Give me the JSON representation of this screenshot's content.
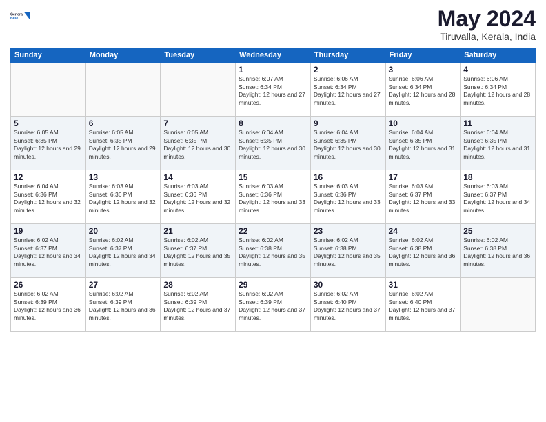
{
  "header": {
    "logo_line1": "General",
    "logo_line2": "Blue",
    "title": "May 2024",
    "subtitle": "Tiruvalla, Kerala, India"
  },
  "weekdays": [
    "Sunday",
    "Monday",
    "Tuesday",
    "Wednesday",
    "Thursday",
    "Friday",
    "Saturday"
  ],
  "weeks": [
    [
      {
        "day": "",
        "empty": true
      },
      {
        "day": "",
        "empty": true
      },
      {
        "day": "",
        "empty": true
      },
      {
        "day": "1",
        "sunrise": "6:07 AM",
        "sunset": "6:34 PM",
        "daylight": "12 hours and 27 minutes."
      },
      {
        "day": "2",
        "sunrise": "6:06 AM",
        "sunset": "6:34 PM",
        "daylight": "12 hours and 27 minutes."
      },
      {
        "day": "3",
        "sunrise": "6:06 AM",
        "sunset": "6:34 PM",
        "daylight": "12 hours and 28 minutes."
      },
      {
        "day": "4",
        "sunrise": "6:06 AM",
        "sunset": "6:34 PM",
        "daylight": "12 hours and 28 minutes."
      }
    ],
    [
      {
        "day": "5",
        "sunrise": "6:05 AM",
        "sunset": "6:35 PM",
        "daylight": "12 hours and 29 minutes."
      },
      {
        "day": "6",
        "sunrise": "6:05 AM",
        "sunset": "6:35 PM",
        "daylight": "12 hours and 29 minutes."
      },
      {
        "day": "7",
        "sunrise": "6:05 AM",
        "sunset": "6:35 PM",
        "daylight": "12 hours and 30 minutes."
      },
      {
        "day": "8",
        "sunrise": "6:04 AM",
        "sunset": "6:35 PM",
        "daylight": "12 hours and 30 minutes."
      },
      {
        "day": "9",
        "sunrise": "6:04 AM",
        "sunset": "6:35 PM",
        "daylight": "12 hours and 30 minutes."
      },
      {
        "day": "10",
        "sunrise": "6:04 AM",
        "sunset": "6:35 PM",
        "daylight": "12 hours and 31 minutes."
      },
      {
        "day": "11",
        "sunrise": "6:04 AM",
        "sunset": "6:35 PM",
        "daylight": "12 hours and 31 minutes."
      }
    ],
    [
      {
        "day": "12",
        "sunrise": "6:04 AM",
        "sunset": "6:36 PM",
        "daylight": "12 hours and 32 minutes."
      },
      {
        "day": "13",
        "sunrise": "6:03 AM",
        "sunset": "6:36 PM",
        "daylight": "12 hours and 32 minutes."
      },
      {
        "day": "14",
        "sunrise": "6:03 AM",
        "sunset": "6:36 PM",
        "daylight": "12 hours and 32 minutes."
      },
      {
        "day": "15",
        "sunrise": "6:03 AM",
        "sunset": "6:36 PM",
        "daylight": "12 hours and 33 minutes."
      },
      {
        "day": "16",
        "sunrise": "6:03 AM",
        "sunset": "6:36 PM",
        "daylight": "12 hours and 33 minutes."
      },
      {
        "day": "17",
        "sunrise": "6:03 AM",
        "sunset": "6:37 PM",
        "daylight": "12 hours and 33 minutes."
      },
      {
        "day": "18",
        "sunrise": "6:03 AM",
        "sunset": "6:37 PM",
        "daylight": "12 hours and 34 minutes."
      }
    ],
    [
      {
        "day": "19",
        "sunrise": "6:02 AM",
        "sunset": "6:37 PM",
        "daylight": "12 hours and 34 minutes."
      },
      {
        "day": "20",
        "sunrise": "6:02 AM",
        "sunset": "6:37 PM",
        "daylight": "12 hours and 34 minutes."
      },
      {
        "day": "21",
        "sunrise": "6:02 AM",
        "sunset": "6:37 PM",
        "daylight": "12 hours and 35 minutes."
      },
      {
        "day": "22",
        "sunrise": "6:02 AM",
        "sunset": "6:38 PM",
        "daylight": "12 hours and 35 minutes."
      },
      {
        "day": "23",
        "sunrise": "6:02 AM",
        "sunset": "6:38 PM",
        "daylight": "12 hours and 35 minutes."
      },
      {
        "day": "24",
        "sunrise": "6:02 AM",
        "sunset": "6:38 PM",
        "daylight": "12 hours and 36 minutes."
      },
      {
        "day": "25",
        "sunrise": "6:02 AM",
        "sunset": "6:38 PM",
        "daylight": "12 hours and 36 minutes."
      }
    ],
    [
      {
        "day": "26",
        "sunrise": "6:02 AM",
        "sunset": "6:39 PM",
        "daylight": "12 hours and 36 minutes."
      },
      {
        "day": "27",
        "sunrise": "6:02 AM",
        "sunset": "6:39 PM",
        "daylight": "12 hours and 36 minutes."
      },
      {
        "day": "28",
        "sunrise": "6:02 AM",
        "sunset": "6:39 PM",
        "daylight": "12 hours and 37 minutes."
      },
      {
        "day": "29",
        "sunrise": "6:02 AM",
        "sunset": "6:39 PM",
        "daylight": "12 hours and 37 minutes."
      },
      {
        "day": "30",
        "sunrise": "6:02 AM",
        "sunset": "6:40 PM",
        "daylight": "12 hours and 37 minutes."
      },
      {
        "day": "31",
        "sunrise": "6:02 AM",
        "sunset": "6:40 PM",
        "daylight": "12 hours and 37 minutes."
      },
      {
        "day": "",
        "empty": true
      }
    ]
  ],
  "labels": {
    "sunrise_prefix": "Sunrise: ",
    "sunset_prefix": "Sunset: ",
    "daylight_prefix": "Daylight: "
  }
}
